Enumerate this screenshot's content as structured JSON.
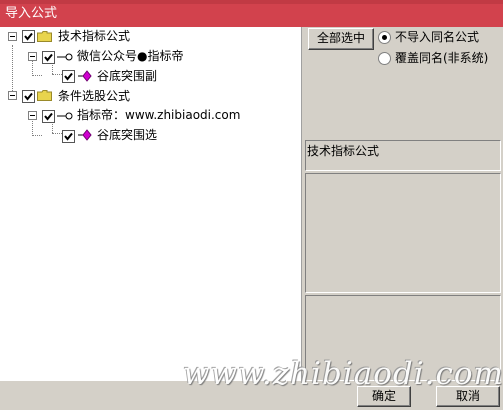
{
  "window": {
    "title": "导入公式"
  },
  "tree": {
    "nodes": [
      {
        "label": "技术指标公式",
        "checked": true
      },
      {
        "label": "微信公众号●指标帝",
        "checked": true
      },
      {
        "label": "谷底突围副",
        "checked": true
      },
      {
        "label": "条件选股公式",
        "checked": true
      },
      {
        "label": "指标帝：www.zhibiaodi.com",
        "checked": true
      },
      {
        "label": "谷底突围选",
        "checked": true
      }
    ]
  },
  "options": {
    "select_all_label": "全部选中",
    "radio_no_import": "不导入同名公式",
    "radio_overwrite": "覆盖同名(非系统)",
    "selected": "不导入同名公式"
  },
  "info": {
    "category_label": "技术指标公式"
  },
  "footer": {
    "ok_label": "确定",
    "cancel_label": "取消"
  },
  "watermark": "www.zhibiaodi.com",
  "colors": {
    "titlebar": "#d2424d",
    "folder": "#e8d44d",
    "formula_icon": "#d000d0"
  }
}
